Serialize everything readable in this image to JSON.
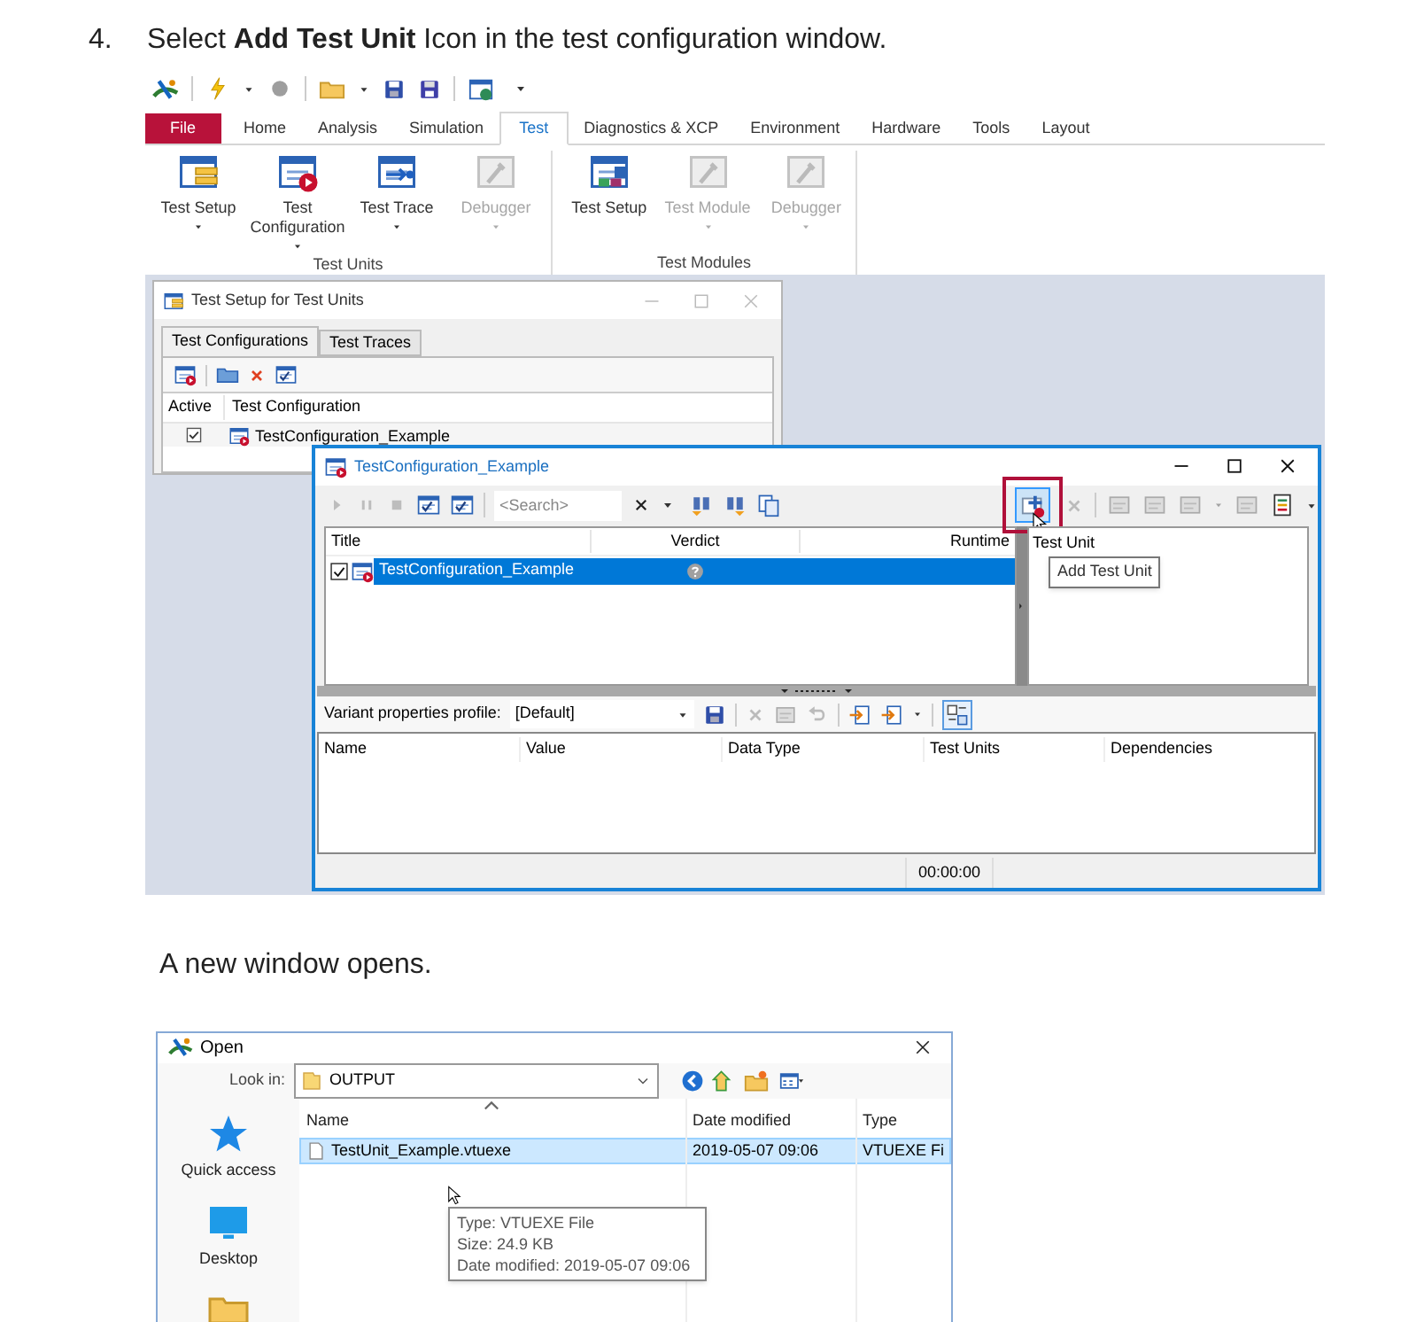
{
  "step": {
    "number": "4.",
    "text": "Select **Add Test Unit** Icon in the test configuration window."
  },
  "ribbon_screenshot": {
    "ribbon_tabs": [
      {
        "label": "File",
        "kind": "file",
        "selected": false
      },
      {
        "label": "Home",
        "kind": "tab",
        "selected": false
      },
      {
        "label": "Analysis",
        "kind": "tab",
        "selected": false
      },
      {
        "label": "Simulation",
        "kind": "tab",
        "selected": false
      },
      {
        "label": "Test",
        "kind": "tab",
        "selected": true
      },
      {
        "label": "Diagnostics & XCP",
        "kind": "tab",
        "selected": false
      },
      {
        "label": "Environment",
        "kind": "tab",
        "selected": false
      },
      {
        "label": "Hardware",
        "kind": "tab",
        "selected": false
      },
      {
        "label": "Tools",
        "kind": "tab",
        "selected": false
      },
      {
        "label": "Layout",
        "kind": "tab",
        "selected": false
      }
    ],
    "ribbon_groups": [
      {
        "label": "Test Units",
        "buttons": [
          {
            "label": "Test Setup",
            "disabled": false,
            "dropdown": true
          },
          {
            "label": "Test Configuration",
            "disabled": false,
            "dropdown": true
          },
          {
            "label": "Test Trace",
            "disabled": false,
            "dropdown": true
          },
          {
            "label": "Debugger",
            "disabled": true,
            "dropdown": true
          }
        ]
      },
      {
        "label": "Test Modules",
        "buttons": [
          {
            "label": "Test Setup",
            "disabled": false,
            "dropdown": false
          },
          {
            "label": "Test Module",
            "disabled": true,
            "dropdown": true
          },
          {
            "label": "Debugger",
            "disabled": true,
            "dropdown": true
          }
        ]
      }
    ],
    "test_setup_window": {
      "title": "Test Setup for Test Units",
      "tabs": [
        {
          "label": "Test Configurations",
          "selected": true
        },
        {
          "label": "Test Traces",
          "selected": false
        }
      ],
      "columns": [
        "Active",
        "Test Configuration"
      ],
      "rows": [
        {
          "active": true,
          "name": "TestConfiguration_Example"
        }
      ]
    },
    "config_window": {
      "title": "TestConfiguration_Example",
      "search": {
        "placeholder": "<Search>"
      },
      "columns": [
        "Title",
        "Verdict",
        "Runtime"
      ],
      "rows": [
        {
          "checked": true,
          "selected": true,
          "title": "TestConfiguration_Example"
        }
      ],
      "test_unit_column": "Test Unit",
      "tooltip": "Add Test Unit",
      "variant_label": "Variant properties profile:",
      "variant_profile": "[Default]",
      "property_columns": [
        "Name",
        "Value",
        "Data Type",
        "Test Units",
        "Dependencies"
      ],
      "status_time": "00:00:00"
    }
  },
  "note": "A new window opens.",
  "open_dialog": {
    "title": "Open",
    "look_in_label": "Look in:",
    "folder": "OUTPUT",
    "places": [
      {
        "label": "Quick access",
        "kind": "star"
      },
      {
        "label": "Desktop",
        "kind": "desktop"
      },
      {
        "kind": "folder"
      }
    ],
    "columns": [
      "Name",
      "Date modified",
      "Type"
    ],
    "files": [
      {
        "name": "TestUnit_Example.vtuexe",
        "date": "2019-05-07 09:06",
        "type": "VTUEXE Fi",
        "selected": true
      }
    ],
    "tooltip": [
      "Type: VTUEXE File",
      "Size: 24.9 KB",
      "Date modified: 2019-05-07 09:06"
    ]
  }
}
